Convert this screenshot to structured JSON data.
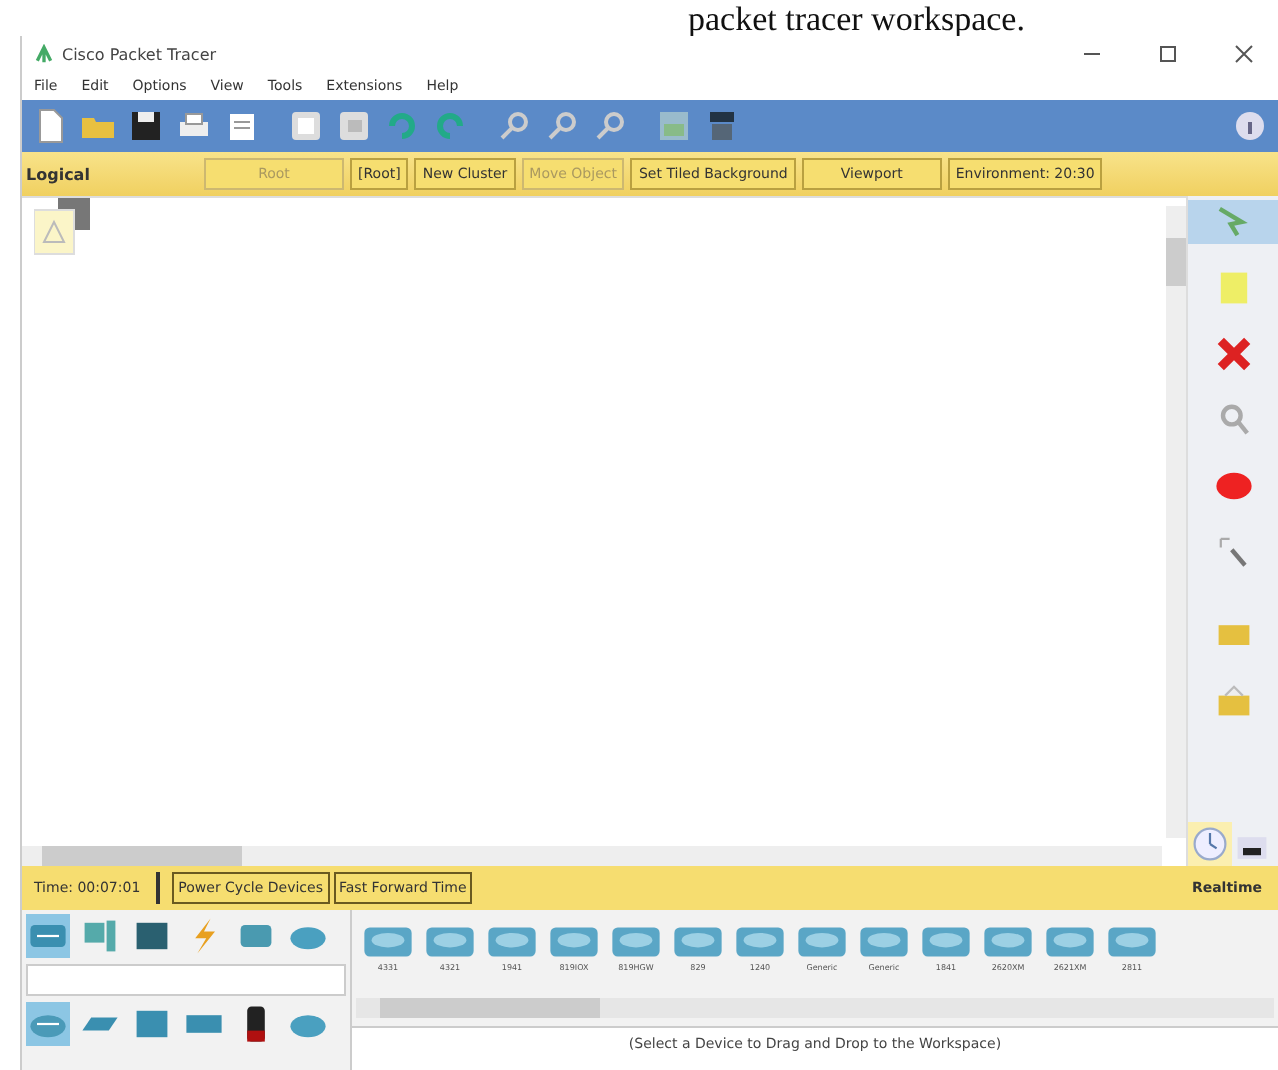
{
  "caption": "packet tracer workspace.",
  "window": {
    "title": "Cisco Packet Tracer"
  },
  "menu": [
    "File",
    "Edit",
    "Options",
    "View",
    "Tools",
    "Extensions",
    "Help"
  ],
  "workspace_bar": {
    "mode": "Logical",
    "buttons": [
      {
        "label": "Root",
        "disabled": true
      },
      {
        "label": "[Root]",
        "disabled": false
      },
      {
        "label": "New Cluster",
        "disabled": false
      },
      {
        "label": "Move Object",
        "disabled": true
      },
      {
        "label": "Set Tiled Background",
        "disabled": false
      },
      {
        "label": "Viewport",
        "disabled": false
      },
      {
        "label": "Environment: 20:30",
        "disabled": false
      }
    ]
  },
  "time_bar": {
    "time": "Time: 00:07:01",
    "buttons": [
      "Power Cycle Devices",
      "Fast Forward Time"
    ],
    "mode": "Realtime"
  },
  "device_panel": {
    "categories": [
      {
        "kind": "network",
        "selected": true
      },
      {
        "kind": "end",
        "selected": false
      },
      {
        "kind": "component",
        "selected": false
      },
      {
        "kind": "connection",
        "selected": false
      },
      {
        "kind": "misc",
        "selected": false
      },
      {
        "kind": "cloud",
        "selected": false
      }
    ],
    "subcategories": [
      {
        "kind": "router",
        "selected": true
      },
      {
        "kind": "switch",
        "selected": false
      },
      {
        "kind": "hub",
        "selected": false
      },
      {
        "kind": "wireless",
        "selected": false
      },
      {
        "kind": "security",
        "selected": false
      },
      {
        "kind": "cloud",
        "selected": false
      }
    ],
    "devices": [
      "4331",
      "4321",
      "1941",
      "819IOX",
      "819HGW",
      "829",
      "1240",
      "Generic",
      "Generic",
      "1841",
      "2620XM",
      "2621XM",
      "2811"
    ],
    "status": "(Select a Device to Drag and Drop to the Workspace)"
  }
}
